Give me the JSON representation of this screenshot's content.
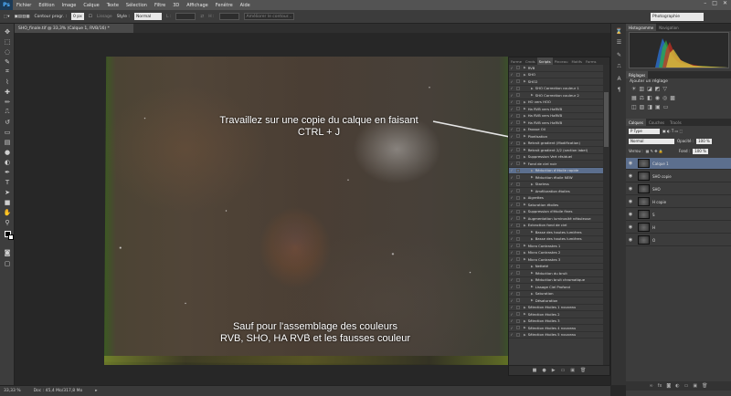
{
  "menubar": {
    "logo": "Ps",
    "items": [
      "Fichier",
      "Edition",
      "Image",
      "Calque",
      "Texte",
      "Sélection",
      "Filtre",
      "3D",
      "Affichage",
      "Fenêtre",
      "Aide"
    ],
    "window_controls": [
      "–",
      "□",
      "✕"
    ]
  },
  "options": {
    "contour_label": "Contour progr. :",
    "contour_value": "0 px",
    "lissage_label": "Lissage",
    "style_label": "Style :",
    "style_value": "Normal",
    "l_label": "L :",
    "h_label": "H :",
    "refine_label": "Améliorer le contour...",
    "workspace": "Photographie"
  },
  "document": {
    "tab_title": "SHO_finale.tif @ 33,3% (Calque 1, RVB/16) *",
    "annotation_top_line1": "Travaillez sur une copie du calque en faisant",
    "annotation_top_line2": "CTRL + J",
    "annotation_bottom_line1": "Sauf pour l'assemblage des couleurs",
    "annotation_bottom_line2": "RVB, SHO, HA RVB et les fausses couleur"
  },
  "status": {
    "zoom": "33,33 %",
    "doc": "Doc : 45,4 Mo/317,8 Mo"
  },
  "actions_panel": {
    "tabs": [
      "Forme",
      "Cmds",
      "Scripts",
      "Pinceau",
      "Motifs",
      "Forms"
    ],
    "active_tab": "Scripts",
    "rows": [
      {
        "label": "RVB",
        "indent": 1,
        "sel": false
      },
      {
        "label": "SHO",
        "indent": 1,
        "sel": false
      },
      {
        "label": "SHO2",
        "indent": 1,
        "sel": false
      },
      {
        "label": "SHO Correction couleur 1",
        "indent": 2,
        "sel": false
      },
      {
        "label": "SHO Correction couleur 2",
        "indent": 2,
        "sel": false
      },
      {
        "label": "HO vers HOO",
        "indent": 1,
        "sel": false
      },
      {
        "label": "Ha RVB vers HaRVB",
        "indent": 1,
        "sel": false
      },
      {
        "label": "Ha RVB vers HaRVB",
        "indent": 1,
        "sel": false
      },
      {
        "label": "Ha RVB vers HaRVB",
        "indent": 1,
        "sel": false
      },
      {
        "label": "Fausse Oil",
        "indent": 1,
        "sel": false
      },
      {
        "label": "Pixelisation",
        "indent": 1,
        "sel": false
      },
      {
        "label": "Retrait gradient (Modification)",
        "indent": 1,
        "sel": false
      },
      {
        "label": "Retrait gradient 2/2 (section label)",
        "indent": 1,
        "sel": false
      },
      {
        "label": "Suppression Vert résiduel",
        "indent": 1,
        "sel": false
      },
      {
        "label": "Fond de ciel noir",
        "indent": 1,
        "sel": false
      },
      {
        "label": "Réduction d'étoile rapide",
        "indent": 2,
        "sel": true
      },
      {
        "label": "Réduction étoile NEW",
        "indent": 2,
        "sel": false
      },
      {
        "label": "Starless",
        "indent": 2,
        "sel": false
      },
      {
        "label": "Amélioration étoiles",
        "indent": 2,
        "sel": false
      },
      {
        "label": "Aigrettes",
        "indent": 1,
        "sel": false
      },
      {
        "label": "Saturation étoiles",
        "indent": 1,
        "sel": false
      },
      {
        "label": "Suppression d'étoile fines",
        "indent": 1,
        "sel": false
      },
      {
        "label": "Augmentation luminosité nébuleuse",
        "indent": 1,
        "sel": false
      },
      {
        "label": "Extraction fond de ciel",
        "indent": 1,
        "sel": false
      },
      {
        "label": "Basse des hautes lumières",
        "indent": 2,
        "sel": false
      },
      {
        "label": "Basse des hautes lumières",
        "indent": 2,
        "sel": false
      },
      {
        "label": "Micro Contrastes 1",
        "indent": 1,
        "sel": false
      },
      {
        "label": "Micro Contrastes 2",
        "indent": 1,
        "sel": false
      },
      {
        "label": "Micro Contrastes 3",
        "indent": 1,
        "sel": false
      },
      {
        "label": "Netteté",
        "indent": 2,
        "sel": false
      },
      {
        "label": "Réduction du bruit",
        "indent": 2,
        "sel": false
      },
      {
        "label": "Réduction bruit chromatique",
        "indent": 2,
        "sel": false
      },
      {
        "label": "Lissage Ciel Profond",
        "indent": 2,
        "sel": false
      },
      {
        "label": "Saturation",
        "indent": 2,
        "sel": false
      },
      {
        "label": "Désaturation",
        "indent": 2,
        "sel": false
      },
      {
        "label": "Sélection étoiles 1 nouveau",
        "indent": 1,
        "sel": false
      },
      {
        "label": "Sélection étoiles 2",
        "indent": 1,
        "sel": false
      },
      {
        "label": "Sélection étoiles 3",
        "indent": 1,
        "sel": false
      },
      {
        "label": "Sélection étoiles 4 nouveau",
        "indent": 1,
        "sel": false
      },
      {
        "label": "Sélection étoiles 5 nouveau",
        "indent": 1,
        "sel": false
      }
    ]
  },
  "right_panel": {
    "histo_tabs": [
      "Histogramme",
      "Navigation"
    ],
    "adj_tabs": [
      "Réglages"
    ],
    "adj_label": "Ajouter un réglage",
    "layer_tabs": [
      "Calques",
      "Couches",
      "Tracés"
    ],
    "kind_value": "P Type",
    "blend_value": "Normal",
    "opacity_label": "Opacité :",
    "opacity_value": "100 %",
    "lock_label": "Verrou :",
    "fill_label": "Fond :",
    "fill_value": "100 %",
    "layers": [
      {
        "name": "Calque 1",
        "sel": true
      },
      {
        "name": "SHO copie",
        "sel": false
      },
      {
        "name": "SHO",
        "sel": false
      },
      {
        "name": "H copie",
        "sel": false
      },
      {
        "name": "S",
        "sel": false
      },
      {
        "name": "H",
        "sel": false
      },
      {
        "name": "O",
        "sel": false
      }
    ]
  }
}
